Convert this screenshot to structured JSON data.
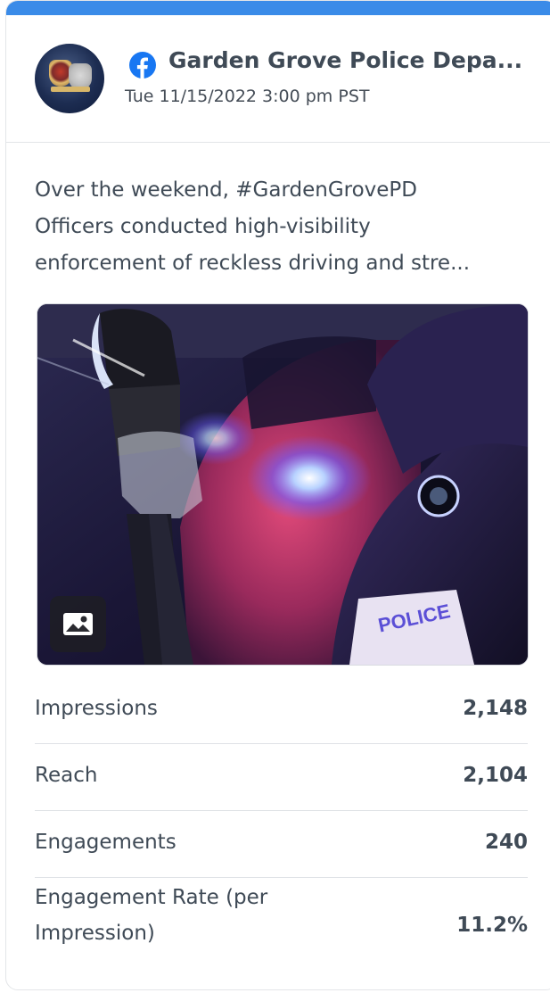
{
  "post": {
    "page_name": "Garden Grove Police Depa...",
    "network_icon": "facebook-icon",
    "date": "Tue 11/15/2022 3:00 pm PST",
    "text_lines": [
      "Over the weekend, #GardenGrovePD",
      "Officers conducted high-visibility",
      "enforcement of reckless driving and stre..."
    ],
    "image_badge_icon": "image-icon",
    "photo_text": "POLICE"
  },
  "metrics": [
    {
      "label": "Impressions",
      "value": "2,148"
    },
    {
      "label": "Reach",
      "value": "2,104"
    },
    {
      "label": "Engagements",
      "value": "240"
    },
    {
      "label": "Engagement Rate (per Impression)",
      "value": "11.2%"
    }
  ],
  "colors": {
    "accent": "#3a8be8",
    "facebook": "#1877f2",
    "text": "#3f4a56"
  }
}
